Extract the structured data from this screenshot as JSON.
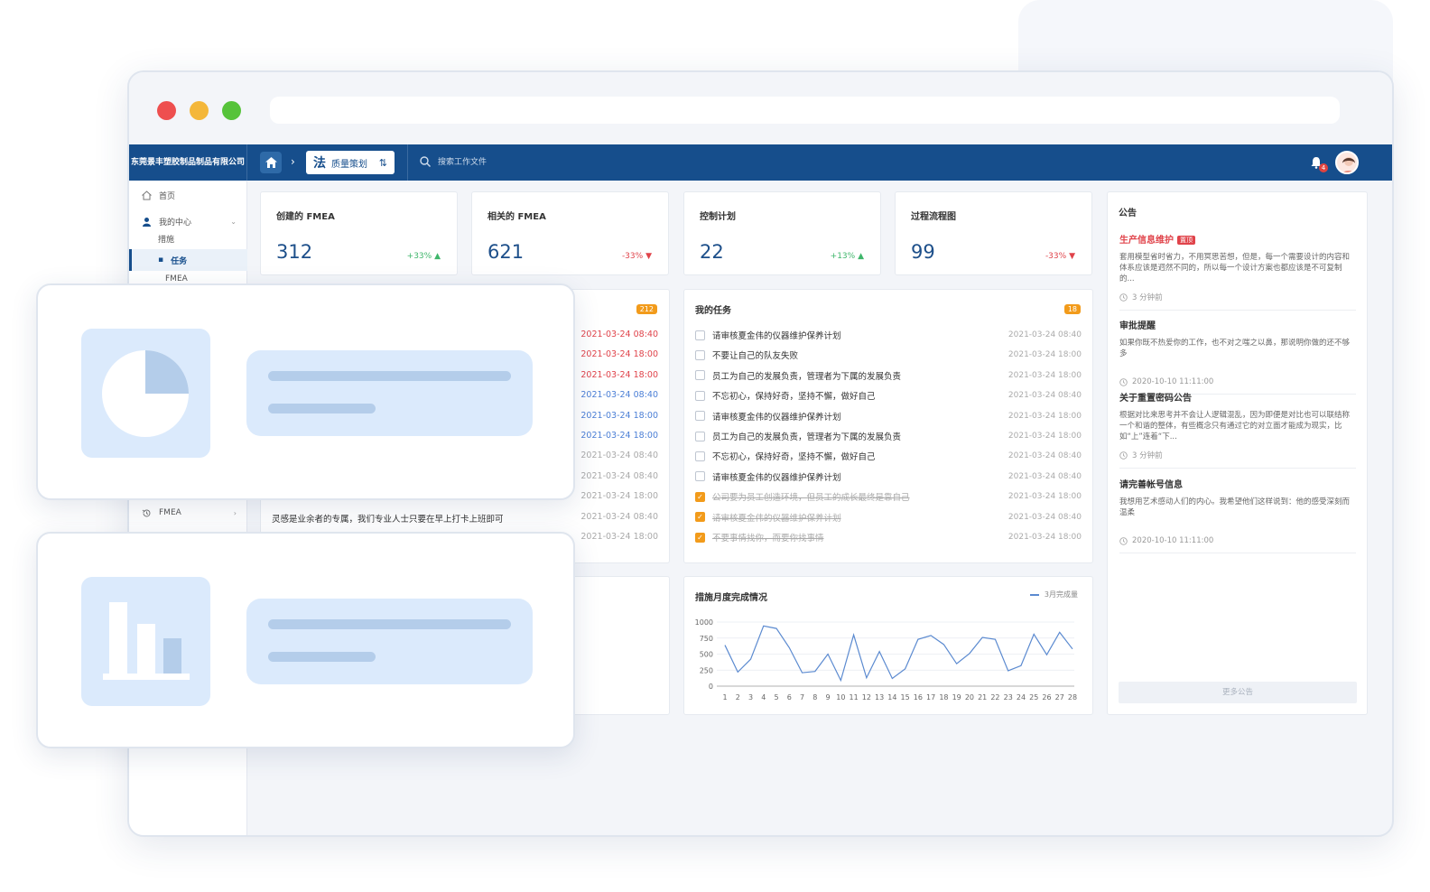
{
  "header": {
    "company": "东莞景丰塑胶制品制品有限公司",
    "module_glyph": "法",
    "module_label": "质量策划",
    "module_switch_glyph": "⇅",
    "search_placeholder": "搜索工作文件",
    "bell_count": "4"
  },
  "sidebar": {
    "home": "首页",
    "my_center": "我的中心",
    "sub_measures": "措施",
    "sub_tasks": "任务",
    "sub_fmea": "FMEA",
    "fmea": "FMEA"
  },
  "stats": [
    {
      "label": "创建的 FMEA",
      "value": "312",
      "change": "+33%",
      "trend": "up"
    },
    {
      "label": "相关的 FMEA",
      "value": "621",
      "change": "-33%",
      "trend": "down"
    },
    {
      "label": "控制计划",
      "value": "22",
      "change": "+13%",
      "trend": "up"
    },
    {
      "label": "过程流程图",
      "value": "99",
      "change": "-33%",
      "trend": "down"
    }
  ],
  "left_list": {
    "count": "212",
    "times": [
      {
        "t": "2021-03-24 08:40",
        "c": "#e0434a"
      },
      {
        "t": "2021-03-24 18:00",
        "c": "#e0434a"
      },
      {
        "t": "2021-03-24 18:00",
        "c": "#e0434a"
      },
      {
        "t": "2021-03-24 08:40",
        "c": "#4b7fd6"
      },
      {
        "t": "2021-03-24 18:00",
        "c": "#4b7fd6"
      },
      {
        "t": "2021-03-24 18:00",
        "c": "#4b7fd6"
      },
      {
        "t": "2021-03-24 08:40",
        "c": "#aaaaaa"
      },
      {
        "t": "2021-03-24 08:40",
        "c": "#aaaaaa"
      },
      {
        "t": "2021-03-24 18:00",
        "c": "#aaaaaa"
      },
      {
        "t": "2021-03-24 08:40",
        "c": "#aaaaaa"
      },
      {
        "t": "2021-03-24 18:00",
        "c": "#aaaaaa"
      }
    ],
    "visible_text": "灵感是业余者的专属，我们专业人士只要在早上打卡上班即可"
  },
  "tasks": {
    "title": "我的任务",
    "count": "18",
    "items": [
      {
        "text": "请审核夏金伟的仪器维护保养计划",
        "date": "2021-03-24 08:40",
        "done": false
      },
      {
        "text": "不要让自己的队友失败",
        "date": "2021-03-24 18:00",
        "done": false
      },
      {
        "text": "员工为自己的发展负责，管理者为下属的发展负责",
        "date": "2021-03-24 18:00",
        "done": false
      },
      {
        "text": "不忘初心，保持好奇，坚持不懈，做好自己",
        "date": "2021-03-24 08:40",
        "done": false
      },
      {
        "text": "请审核夏金伟的仪器维护保养计划",
        "date": "2021-03-24 18:00",
        "done": false
      },
      {
        "text": "员工为自己的发展负责，管理者为下属的发展负责",
        "date": "2021-03-24 18:00",
        "done": false
      },
      {
        "text": "不忘初心，保持好奇，坚持不懈，做好自己",
        "date": "2021-03-24 08:40",
        "done": false
      },
      {
        "text": "请审核夏金伟的仪器维护保养计划",
        "date": "2021-03-24 08:40",
        "done": false
      },
      {
        "text": "公司要为员工创造环境，但员工的成长最终是靠自己",
        "date": "2021-03-24 18:00",
        "done": true
      },
      {
        "text": "请审核夏金伟的仪器维护保养计划",
        "date": "2021-03-24 08:40",
        "done": true
      },
      {
        "text": "不要事情找你，而要你找事情",
        "date": "2021-03-24 18:00",
        "done": true
      }
    ]
  },
  "chart_data": {
    "type": "line",
    "title": "措施月度完成情况",
    "series": [
      {
        "name": "3月完成量",
        "values": [
          640,
          220,
          420,
          940,
          900,
          600,
          210,
          230,
          500,
          90,
          800,
          130,
          540,
          120,
          270,
          730,
          790,
          650,
          350,
          510,
          760,
          730,
          240,
          320,
          810,
          490,
          840,
          580
        ]
      }
    ],
    "x": [
      "1",
      "2",
      "3",
      "4",
      "5",
      "6",
      "7",
      "8",
      "9",
      "10",
      "11",
      "12",
      "13",
      "14",
      "15",
      "16",
      "17",
      "18",
      "19",
      "20",
      "21",
      "22",
      "23",
      "24",
      "25",
      "26",
      "27",
      "28"
    ],
    "yticks": [
      "0",
      "250",
      "500",
      "750",
      "1000"
    ],
    "ylim": [
      0,
      1000
    ],
    "grid": true,
    "legend": "top-right",
    "color": "#5b8ad0"
  },
  "notices": {
    "title": "公告",
    "items": [
      {
        "title": "生产信息维护",
        "tag": "置顶",
        "hot": true,
        "body": "套用模型省时省力，不用冥思苦想，但是，每一个需要设计的内容和体系应该是迥然不同的，所以每一个设计方案也都应该是不可复制的...",
        "time": "3 分钟前"
      },
      {
        "title": "审批提醒",
        "tag": "",
        "hot": false,
        "body": "如果你既不热爱你的工作，也不对之嗤之以鼻，那说明你做的还不够多",
        "time": "2020-10-10 11:11:00"
      },
      {
        "title": "关于重置密码公告",
        "tag": "",
        "hot": false,
        "body": "根据对比来思考并不会让人逻辑混乱，因为即便是对比也可以联结称一个和谐的整体，有些概念只有通过它的对立面才能成为现实，比如“上”连着“下...",
        "time": "3 分钟前"
      },
      {
        "title": "请完善帐号信息",
        "tag": "",
        "hot": false,
        "body": "我想用艺术感动人们的内心。我希望他们这样说到：他的感受深刻而温柔",
        "time": "2020-10-10 11:11:00"
      }
    ],
    "more": "更多公告"
  }
}
